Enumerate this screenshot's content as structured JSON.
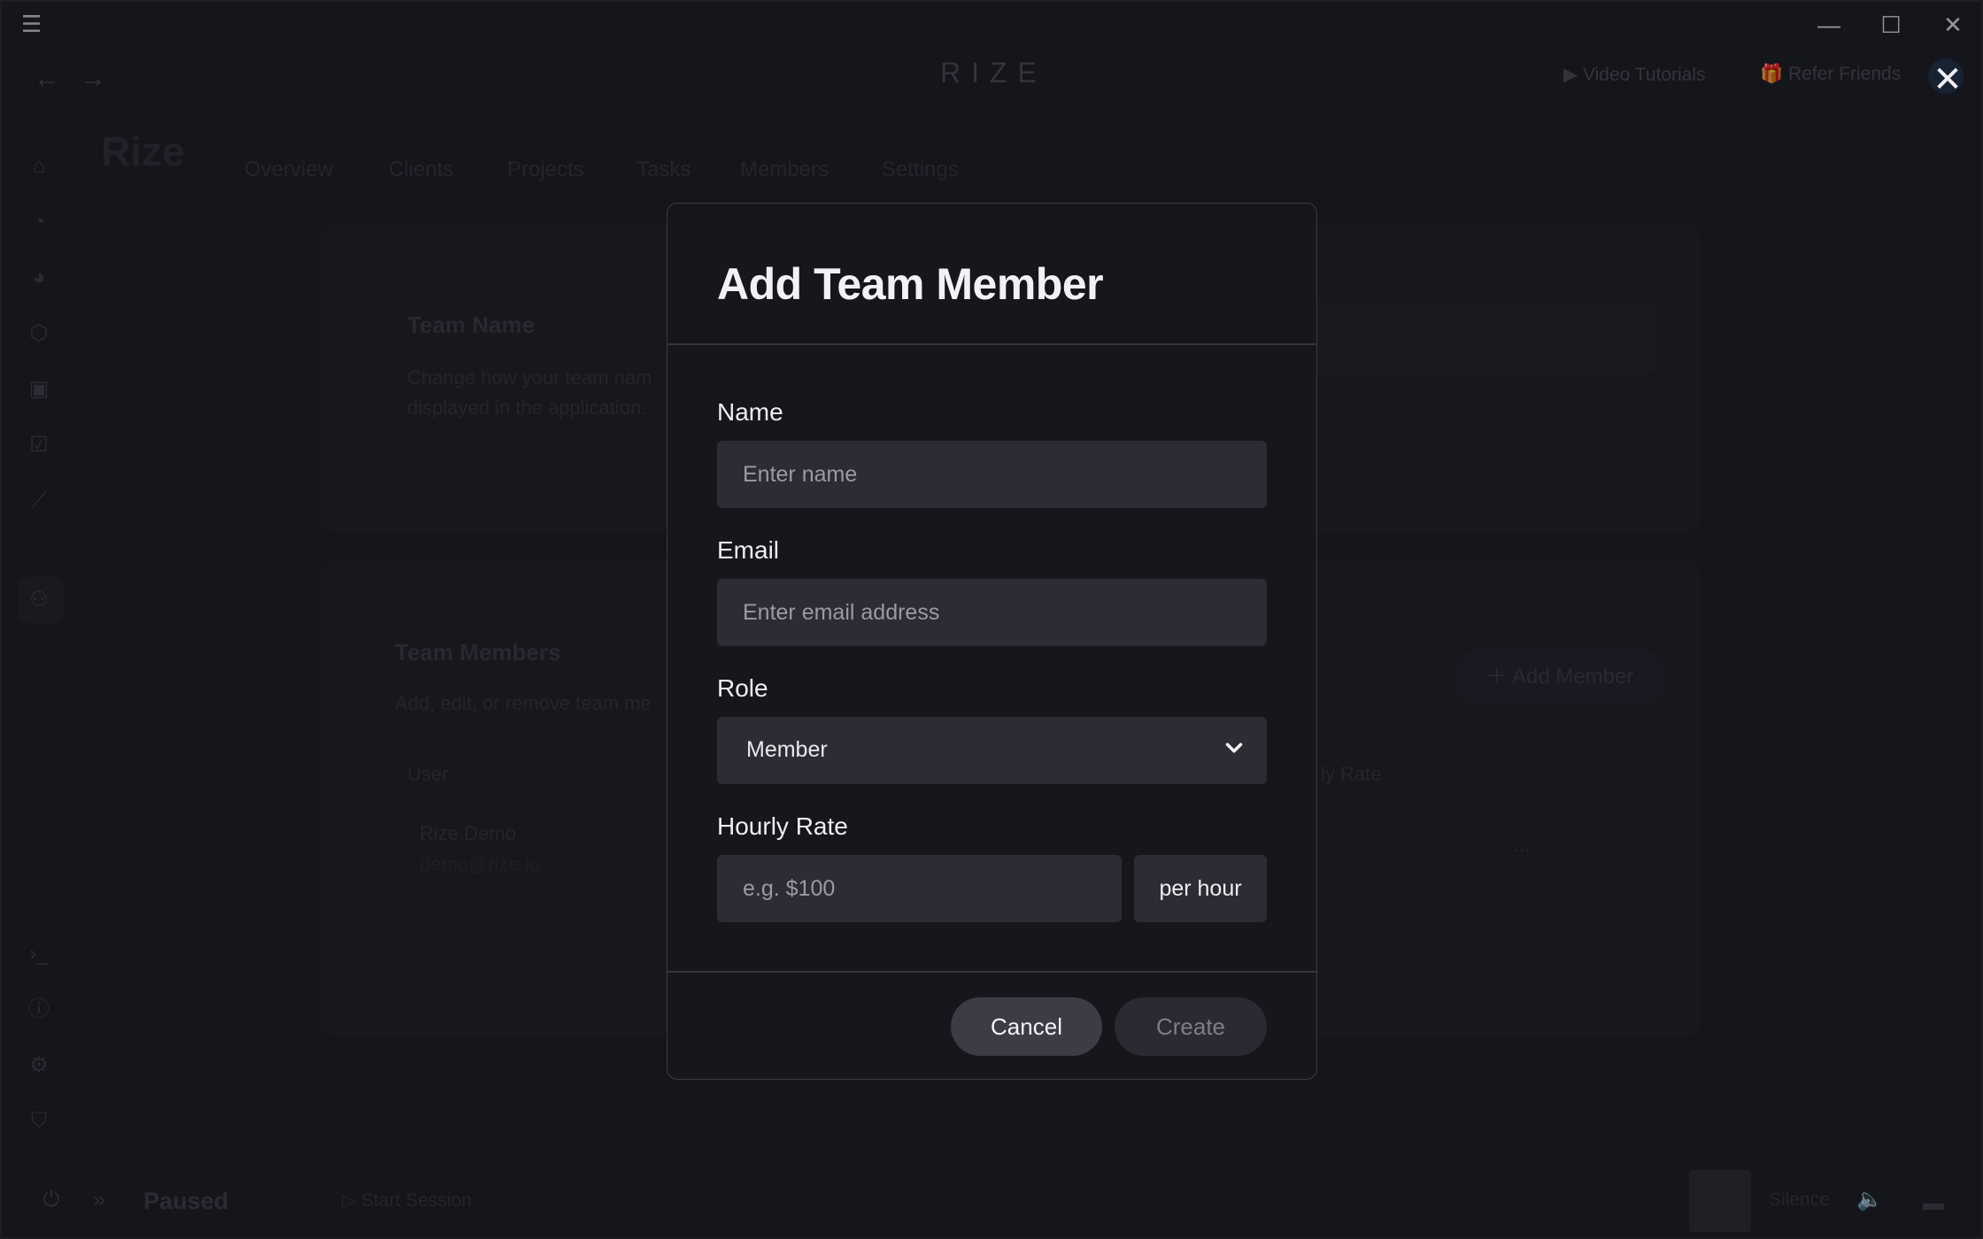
{
  "brand": "RIZE",
  "top_links": {
    "video_tutorials": "Video Tutorials",
    "refer_friends": "Refer Friends"
  },
  "page": {
    "title": "Rize",
    "tabs": [
      "Overview",
      "Clients",
      "Projects",
      "Tasks",
      "Members",
      "Settings"
    ],
    "team_name": {
      "heading": "Team Name",
      "desc_line1": "Change how your team nam",
      "desc_line2": "displayed in the application."
    },
    "team_members": {
      "heading": "Team Members",
      "desc": "Add, edit, or remove team me",
      "col_user": "User",
      "col_rate": "ly Rate",
      "row_name": "Rize Demo",
      "row_email": "demo@rize.io",
      "row_more": "...",
      "add_member": "Add Member"
    }
  },
  "footer": {
    "status": "Paused",
    "start_session": "Start Session",
    "silence": "Silence"
  },
  "modal": {
    "title": "Add Team Member",
    "name_label": "Name",
    "name_placeholder": "Enter name",
    "email_label": "Email",
    "email_placeholder": "Enter email address",
    "role_label": "Role",
    "role_value": "Member",
    "rate_label": "Hourly Rate",
    "rate_placeholder": "e.g. $100",
    "rate_unit": "per hour",
    "cancel": "Cancel",
    "create": "Create"
  }
}
